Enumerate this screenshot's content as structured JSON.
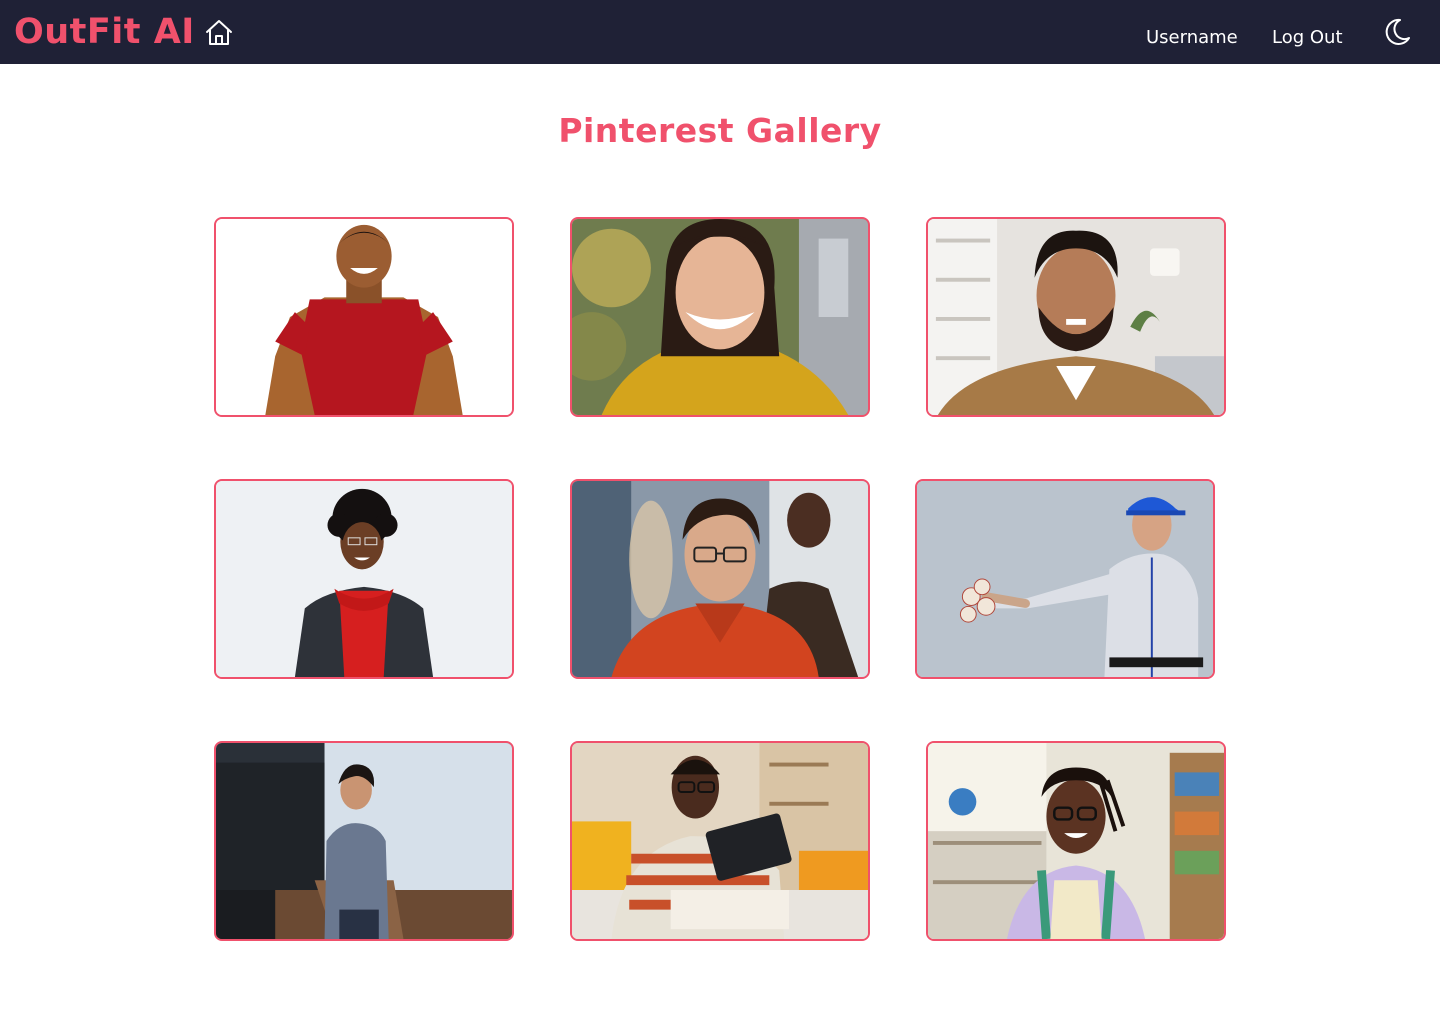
{
  "navbar": {
    "brand": "OutFit AI",
    "home_icon": "home-icon",
    "username": "Username",
    "logout": "Log Out",
    "theme_icon": "moon-icon"
  },
  "page": {
    "title": "Pinterest Gallery"
  },
  "gallery": {
    "items": [
      {
        "subject": "man in red t-shirt"
      },
      {
        "subject": "woman in yellow sweater"
      },
      {
        "subject": "bearded man in brown shirt"
      },
      {
        "subject": "man in red hoodie and denim jacket"
      },
      {
        "subject": "man with glasses in orange shirt"
      },
      {
        "subject": "baseball player holding balls"
      },
      {
        "subject": "young man on a stage"
      },
      {
        "subject": "man with tablet at desk"
      },
      {
        "subject": "girl with glasses in library"
      }
    ]
  },
  "colors": {
    "accent": "#f0516c",
    "navbar_bg": "#1f2136",
    "nav_text": "#ffffff",
    "page_bg": "#ffffff"
  }
}
